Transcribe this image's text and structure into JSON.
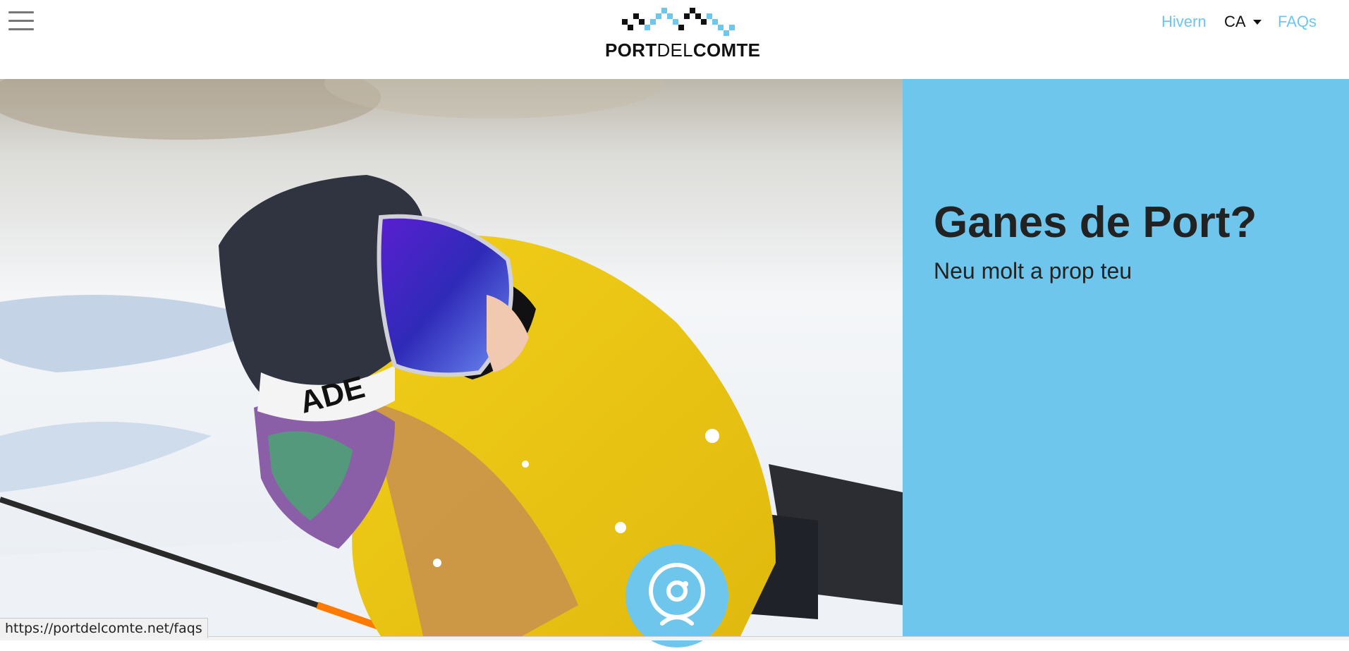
{
  "header": {
    "menu_icon": "hamburger-menu-icon",
    "logo": {
      "part1": "PORT",
      "part2": "DEL",
      "part3": "COMTE"
    },
    "nav": {
      "winter": "Hivern",
      "language": "CA",
      "faqs": "FAQs"
    }
  },
  "hero": {
    "title": "Ganes de Port?",
    "subtitle": "Neu molt a prop teu",
    "panel_color": "#6ec6ed",
    "photo_icon": "skier-photo"
  },
  "webcam": {
    "icon": "webcam-icon"
  },
  "status_bar": {
    "url": "https://portdelcomte.net/faqs"
  },
  "colors": {
    "accent": "#6ec6ed",
    "text_dark": "#222222"
  }
}
